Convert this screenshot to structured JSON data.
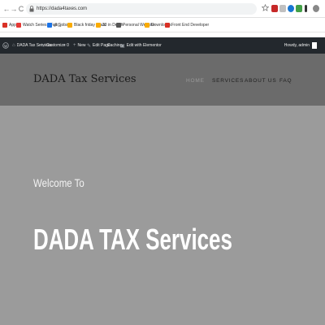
{
  "browser": {
    "url": "https://dada4taxes.com",
    "nav_back": "←",
    "nav_forward": "→",
    "nav_reload": "C",
    "icons": [
      "lock-icon",
      "star-icon",
      "extension-icon",
      "menu-icon"
    ]
  },
  "bookmarks": [
    {
      "label": "Apps",
      "color": "#d93025"
    },
    {
      "label": "Watch Series - Full S",
      "color": "#e53935"
    },
    {
      "label": "go_jobs",
      "color": "#1a73e8"
    },
    {
      "label": "Black friday deals",
      "color": "#f9ab00"
    },
    {
      "label": "33 in Depth",
      "color": "#f9ab00"
    },
    {
      "label": "Personal Website",
      "color": "#555555"
    },
    {
      "label": "Downloads",
      "color": "#f9ab00"
    },
    {
      "label": "Front End Developer",
      "color": "#d93025"
    }
  ],
  "wp_bar": {
    "items": [
      {
        "label": "",
        "icon": "wordpress-icon"
      },
      {
        "label": "DADA Tax Services",
        "icon": "home-icon"
      },
      {
        "label": "Customize",
        "icon": "brush-icon"
      },
      {
        "label": "0",
        "icon": "comment-icon"
      },
      {
        "label": "New",
        "icon": "plus-icon"
      },
      {
        "label": "Edit Page",
        "icon": "pencil-icon"
      },
      {
        "label": "Caching",
        "icon": ""
      },
      {
        "label": "Edit with Elementor",
        "icon": "elementor-icon"
      }
    ],
    "howdy": "Howdy, admin"
  },
  "site": {
    "title": "DADA Tax Services",
    "menu": [
      "HOME",
      "SERVICES",
      "ABOUT US",
      "FAQ"
    ],
    "active_menu": "HOME"
  },
  "hero": {
    "welcome": "Welcome To",
    "title": "DADA TAX Services"
  },
  "colors": {
    "header_bg": "#6b6b6b",
    "hero_bg": "#9b9b9b",
    "wp_bar_bg": "#23282d"
  }
}
